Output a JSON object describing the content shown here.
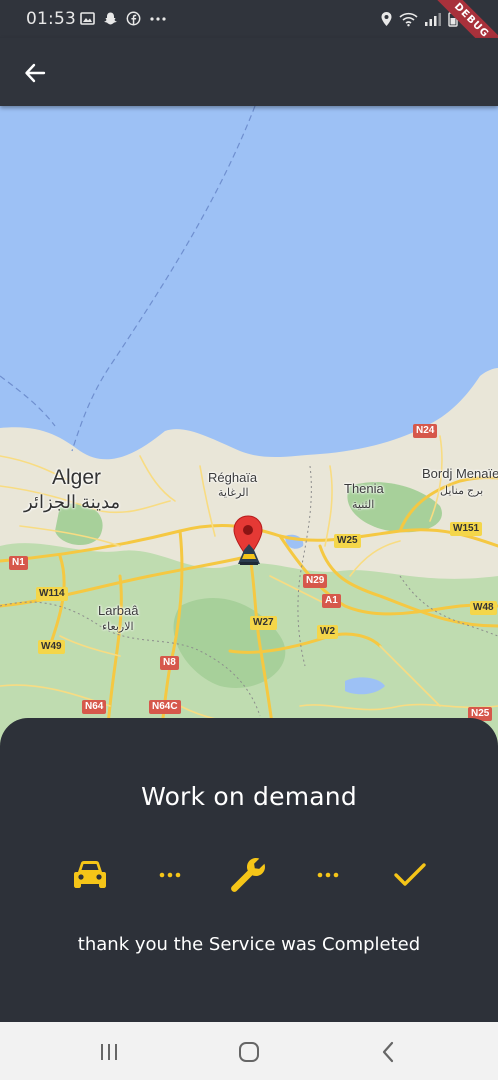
{
  "status_bar": {
    "time": "01:53",
    "left_icons": [
      "image-icon",
      "snapchat-icon",
      "facebook-icon",
      "more-dots-icon"
    ],
    "right_icons": [
      "location-icon",
      "wifi-icon",
      "signal-icon",
      "battery-icon"
    ],
    "debug_banner": "DEBUG"
  },
  "app_bar": {
    "back_icon": "arrow-back-icon"
  },
  "map": {
    "labels": {
      "alger": "Alger",
      "alger_ar": "مدينة الجزائر",
      "reghaia": "Réghaïa",
      "reghaia_ar": "الرغاية",
      "thenia": "Thenia",
      "thenia_ar": "الثنية",
      "bordj": "Bordj Menaïel",
      "bordj_ar": "برج منايل",
      "larbaa": "Larbaâ",
      "larbaa_ar": "الاربعاء"
    },
    "roads": {
      "n24": "N24",
      "n1": "N1",
      "w114": "W114",
      "w49": "W49",
      "n8": "N8",
      "n64": "N64",
      "n64c": "N64C",
      "w25": "W25",
      "n29": "N29",
      "a1": "A1",
      "w27": "W27",
      "w2": "W2",
      "w151": "W151",
      "w48": "W48",
      "n25": "N25"
    },
    "marker_icon": "map-pin-icon",
    "worker_icon": "worker-icon"
  },
  "sheet": {
    "title": "Work on demand",
    "steps": [
      {
        "icon": "car-icon",
        "color": "#f5c518"
      },
      {
        "icon": "dots-icon",
        "color": "#f5c518"
      },
      {
        "icon": "wrench-icon",
        "color": "#f5c518"
      },
      {
        "icon": "dots-icon",
        "color": "#f5c518"
      },
      {
        "icon": "check-icon",
        "color": "#f5c518"
      }
    ],
    "message": "thank you the Service was Completed"
  },
  "nav_bar": {
    "buttons": [
      "recents-icon",
      "home-icon",
      "back-nav-icon"
    ]
  },
  "colors": {
    "background": "#2d3139",
    "accent": "#f5c518",
    "water": "#9dc1f5",
    "land": "#e9e6d8",
    "marker": "#e53935"
  }
}
